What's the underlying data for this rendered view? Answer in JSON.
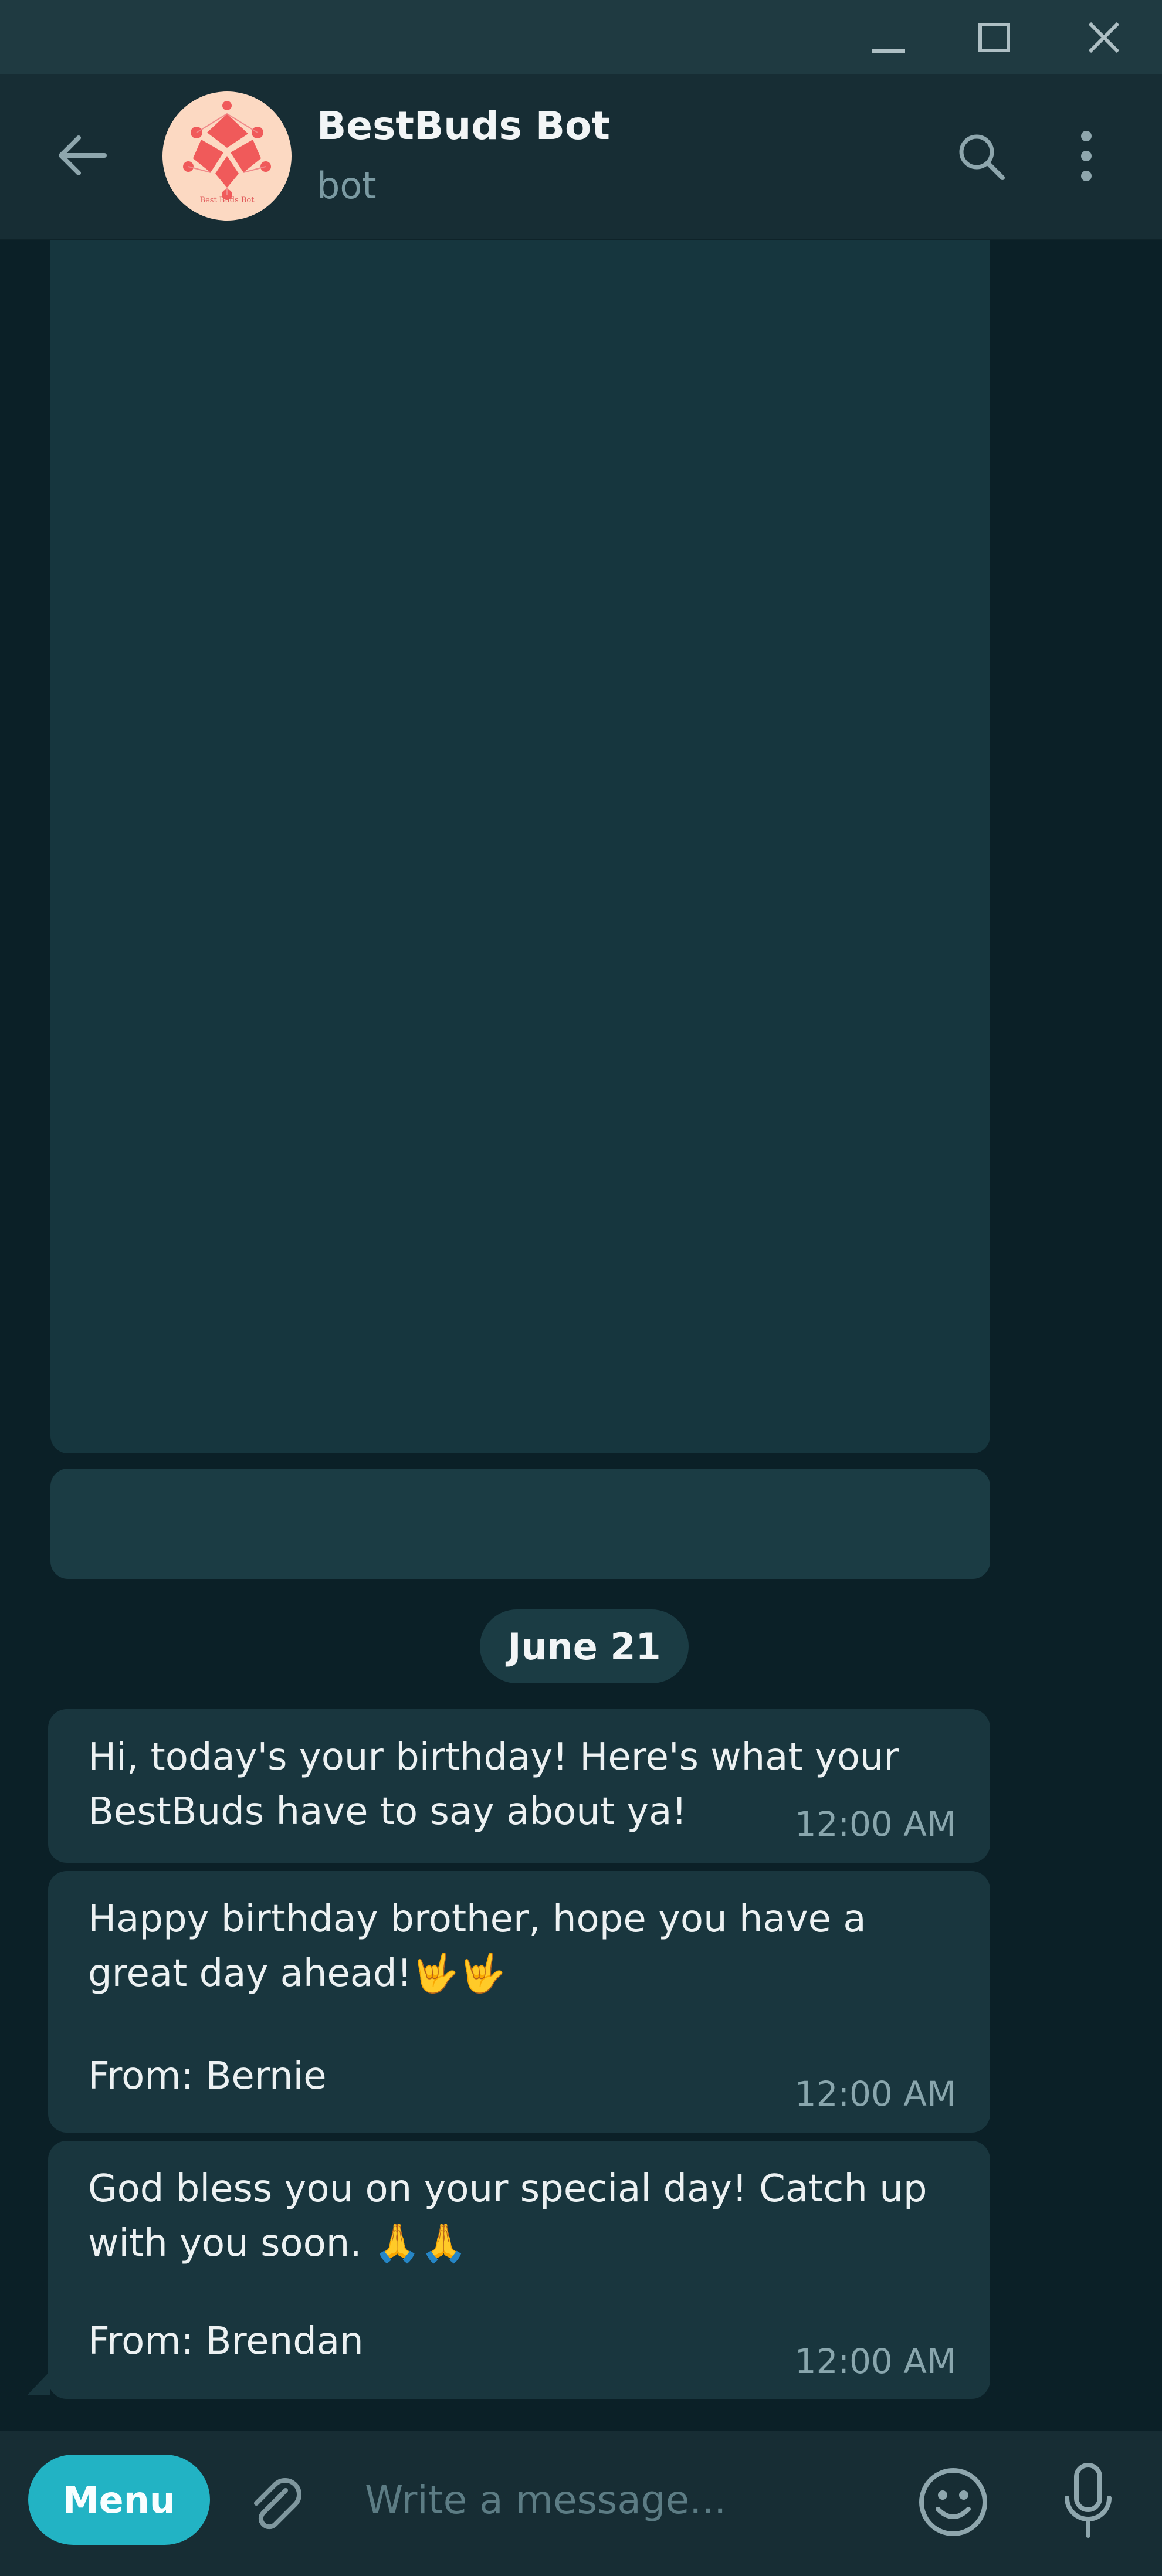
{
  "header": {
    "title": "BestBuds Bot",
    "subtitle": "bot",
    "avatar_text": "Best Buds Bot"
  },
  "chat": {
    "date_separator": "June 21",
    "messages": [
      {
        "line1": "Hi, today's your birthday! Here's what your",
        "line2": "BestBuds have to say about ya!",
        "time": "12:00 AM"
      },
      {
        "line1": "Happy birthday brother, hope you have a",
        "line2": "great day ahead!",
        "emoji": "🤟🤟",
        "from": "From: Bernie",
        "time": "12:00 AM"
      },
      {
        "line1": "God bless you on your special day! Catch up",
        "line2": "with you soon. ",
        "emoji": "🙏🙏",
        "from": "From: Brendan",
        "time": "12:00 AM"
      }
    ]
  },
  "composer": {
    "menu_label": "Menu",
    "placeholder": "Write a message..."
  },
  "icons": {
    "back": "arrow-left-icon",
    "search": "search-icon",
    "more": "more-vertical-icon",
    "attach": "paperclip-icon",
    "emoji": "smiley-icon",
    "mic": "microphone-icon",
    "minimize": "minimize-icon",
    "maximize": "maximize-icon",
    "close": "close-icon"
  },
  "colors": {
    "accent": "#22b3c4",
    "header_bg": "#172d34",
    "chat_bg": "#0b2027",
    "bubble_bg": "#19363e",
    "avatar_bg": "#fcd9c2",
    "avatar_fg": "#f05a5a"
  }
}
